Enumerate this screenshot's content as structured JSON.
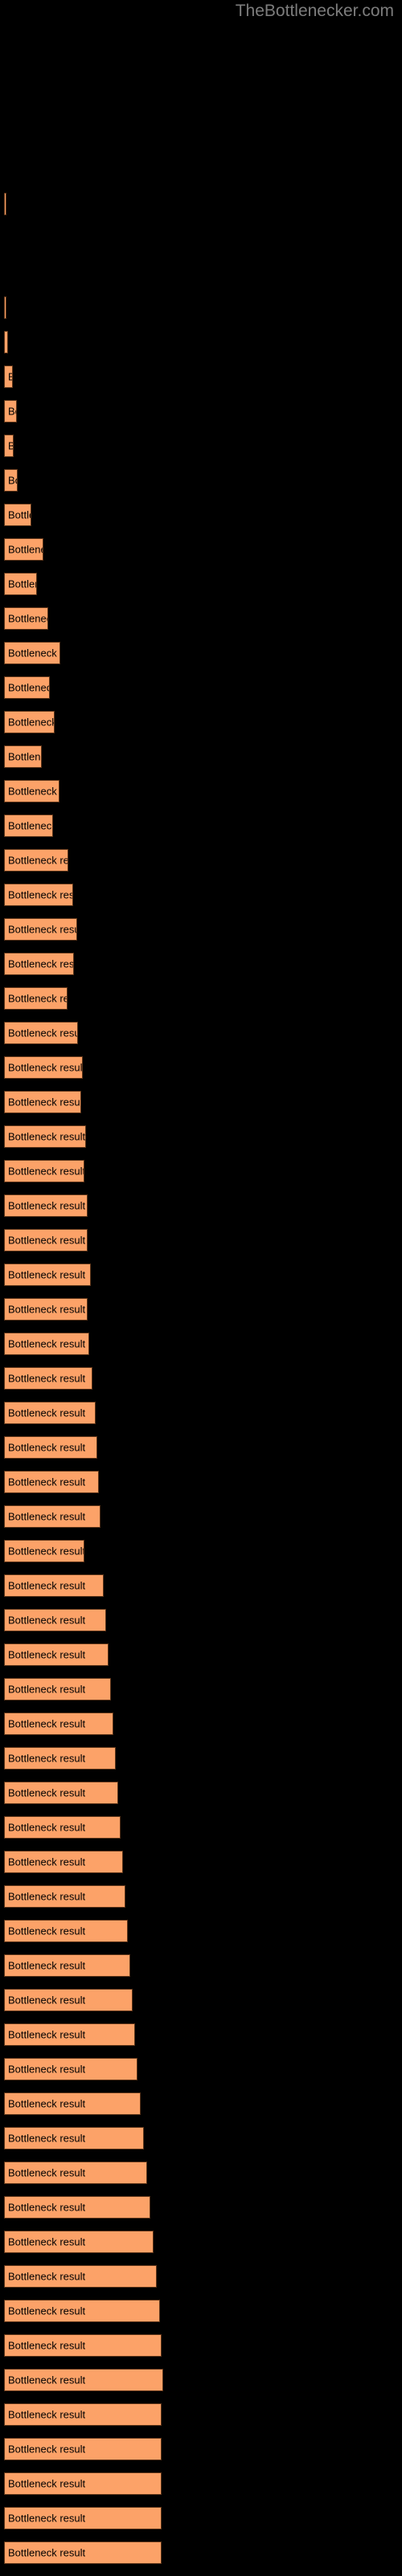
{
  "header": {
    "site_title": "TheBottlenecker.com",
    "title_color": "#7d7d7d"
  },
  "colors": {
    "background": "#000000",
    "bar_fill": "#fca268",
    "bar_border": "#5a3318",
    "bar_label_text": "#000000"
  },
  "chart_data": {
    "type": "bar",
    "orientation": "horizontal",
    "title": "",
    "subtitle": "",
    "xlabel": "",
    "ylabel": "",
    "grid": false,
    "legend": null,
    "axis_visible": false,
    "categories": [
      "",
      "",
      "",
      "",
      "",
      "",
      "",
      "",
      "",
      "",
      "",
      "",
      "",
      "",
      "",
      "",
      "",
      "",
      "",
      "",
      "",
      "",
      "",
      "",
      "",
      "",
      "",
      "",
      "",
      "",
      "",
      "",
      "",
      "",
      "",
      "",
      "",
      "",
      "",
      "",
      "",
      "",
      "",
      "",
      ""
    ],
    "bar_label_text": "Bottleneck result",
    "xlim": [
      0,
      500
    ],
    "values": [
      0,
      0,
      0,
      0,
      0,
      1,
      0,
      0,
      0,
      0,
      0,
      1,
      0,
      0,
      1,
      9,
      14,
      10,
      15,
      19,
      30,
      44,
      57,
      47,
      61,
      70,
      55,
      80,
      65,
      84,
      72,
      95,
      105,
      96,
      114,
      106,
      124,
      115,
      133,
      126,
      146,
      137,
      155,
      148,
      191
    ],
    "bars": [
      {
        "index": 1,
        "y": 240,
        "width": 3,
        "label": "",
        "label_visible": false
      },
      {
        "index": 2,
        "y": 369,
        "width": 3,
        "label": "",
        "label_visible": false
      },
      {
        "index": 3,
        "y": 412,
        "width": 5,
        "label": "",
        "label_visible": false
      },
      {
        "index": 4,
        "y": 455,
        "width": 11,
        "label": "Bottleneck result",
        "label_visible": true
      },
      {
        "index": 5,
        "y": 498,
        "width": 16,
        "label": "Bottleneck result",
        "label_visible": true
      },
      {
        "index": 6,
        "y": 541,
        "width": 12,
        "label": "Bottleneck result",
        "label_visible": true
      },
      {
        "index": 7,
        "y": 584,
        "width": 17,
        "label": "Bottleneck result",
        "label_visible": true
      },
      {
        "index": 8,
        "y": 627,
        "width": 34,
        "label": "Bottleneck result",
        "label_visible": true
      },
      {
        "index": 9,
        "y": 670,
        "width": 49,
        "label": "Bottleneck result",
        "label_visible": true
      },
      {
        "index": 10,
        "y": 713,
        "width": 41,
        "label": "Bottleneck result",
        "label_visible": true
      },
      {
        "index": 11,
        "y": 756,
        "width": 55,
        "label": "Bottleneck result",
        "label_visible": true
      },
      {
        "index": 12,
        "y": 799,
        "width": 70,
        "label": "Bottleneck result",
        "label_visible": true
      },
      {
        "index": 13,
        "y": 842,
        "width": 57,
        "label": "Bottleneck result",
        "label_visible": true
      },
      {
        "index": 14,
        "y": 885,
        "width": 63,
        "label": "Bottleneck result",
        "label_visible": true
      },
      {
        "index": 15,
        "y": 928,
        "width": 47,
        "label": "Bottleneck result",
        "label_visible": true
      },
      {
        "index": 16,
        "y": 971,
        "width": 69,
        "label": "Bottleneck result",
        "label_visible": true
      },
      {
        "index": 17,
        "y": 1014,
        "width": 61,
        "label": "Bottleneck result",
        "label_visible": true
      },
      {
        "index": 18,
        "y": 1057,
        "width": 80,
        "label": "Bottleneck result",
        "label_visible": true
      },
      {
        "index": 19,
        "y": 1100,
        "width": 86,
        "label": "Bottleneck result",
        "label_visible": true
      },
      {
        "index": 20,
        "y": 1143,
        "width": 91,
        "label": "Bottleneck result",
        "label_visible": true
      },
      {
        "index": 21,
        "y": 1186,
        "width": 87,
        "label": "Bottleneck result",
        "label_visible": true
      },
      {
        "index": 22,
        "y": 1229,
        "width": 79,
        "label": "Bottleneck result",
        "label_visible": true
      },
      {
        "index": 23,
        "y": 1272,
        "width": 92,
        "label": "Bottleneck result",
        "label_visible": true
      },
      {
        "index": 24,
        "y": 1315,
        "width": 98,
        "label": "Bottleneck result",
        "label_visible": true
      },
      {
        "index": 25,
        "y": 1358,
        "width": 96,
        "label": "Bottleneck result",
        "label_visible": true
      },
      {
        "index": 26,
        "y": 1401,
        "width": 102,
        "label": "Bottleneck result",
        "label_visible": true
      },
      {
        "index": 27,
        "y": 1444,
        "width": 100,
        "label": "Bottleneck result",
        "label_visible": true
      },
      {
        "index": 28,
        "y": 1487,
        "width": 104,
        "label": "Bottleneck result",
        "label_visible": true
      },
      {
        "index": 29,
        "y": 1530,
        "width": 104,
        "label": "Bottleneck result",
        "label_visible": true
      },
      {
        "index": 30,
        "y": 1573,
        "width": 108,
        "label": "Bottleneck result",
        "label_visible": true
      },
      {
        "index": 31,
        "y": 1616,
        "width": 104,
        "label": "Bottleneck result",
        "label_visible": true
      },
      {
        "index": 32,
        "y": 1659,
        "width": 106,
        "label": "Bottleneck result",
        "label_visible": true
      },
      {
        "index": 33,
        "y": 1702,
        "width": 110,
        "label": "Bottleneck result",
        "label_visible": true
      },
      {
        "index": 34,
        "y": 1745,
        "width": 114,
        "label": "Bottleneck result",
        "label_visible": true
      },
      {
        "index": 35,
        "y": 1788,
        "width": 116,
        "label": "Bottleneck result",
        "label_visible": true
      },
      {
        "index": 36,
        "y": 1831,
        "width": 118,
        "label": "Bottleneck result",
        "label_visible": true
      },
      {
        "index": 37,
        "y": 1874,
        "width": 120,
        "label": "Bottleneck result",
        "label_visible": true
      },
      {
        "index": 38,
        "y": 1917,
        "width": 100,
        "label": "Bottleneck result",
        "label_visible": true
      },
      {
        "index": 39,
        "y": 1960,
        "width": 124,
        "label": "Bottleneck result",
        "label_visible": true
      },
      {
        "index": 40,
        "y": 2003,
        "width": 127,
        "label": "Bottleneck result",
        "label_visible": true
      },
      {
        "index": 41,
        "y": 2046,
        "width": 130,
        "label": "Bottleneck result",
        "label_visible": true
      },
      {
        "index": 42,
        "y": 2089,
        "width": 133,
        "label": "Bottleneck result",
        "label_visible": true
      },
      {
        "index": 43,
        "y": 2132,
        "width": 136,
        "label": "Bottleneck result",
        "label_visible": true
      },
      {
        "index": 44,
        "y": 2175,
        "width": 139,
        "label": "Bottleneck result",
        "label_visible": true
      },
      {
        "index": 45,
        "y": 2218,
        "width": 142,
        "label": "Bottleneck result",
        "label_visible": true
      },
      {
        "index": 46,
        "y": 2261,
        "width": 145,
        "label": "Bottleneck result",
        "label_visible": true
      },
      {
        "index": 47,
        "y": 2304,
        "width": 148,
        "label": "Bottleneck result",
        "label_visible": true
      },
      {
        "index": 48,
        "y": 2347,
        "width": 151,
        "label": "Bottleneck result",
        "label_visible": true
      },
      {
        "index": 49,
        "y": 2390,
        "width": 154,
        "label": "Bottleneck result",
        "label_visible": true
      },
      {
        "index": 50,
        "y": 2433,
        "width": 157,
        "label": "Bottleneck result",
        "label_visible": true
      },
      {
        "index": 51,
        "y": 2476,
        "width": 160,
        "label": "Bottleneck result",
        "label_visible": true
      },
      {
        "index": 52,
        "y": 2519,
        "width": 163,
        "label": "Bottleneck result",
        "label_visible": true
      },
      {
        "index": 53,
        "y": 2562,
        "width": 166,
        "label": "Bottleneck result",
        "label_visible": true
      },
      {
        "index": 54,
        "y": 2605,
        "width": 170,
        "label": "Bottleneck result",
        "label_visible": true
      },
      {
        "index": 55,
        "y": 2648,
        "width": 174,
        "label": "Bottleneck result",
        "label_visible": true
      },
      {
        "index": 56,
        "y": 2691,
        "width": 178,
        "label": "Bottleneck result",
        "label_visible": true
      },
      {
        "index": 57,
        "y": 2734,
        "width": 182,
        "label": "Bottleneck result",
        "label_visible": true
      },
      {
        "index": 58,
        "y": 2777,
        "width": 186,
        "label": "Bottleneck result",
        "label_visible": true
      },
      {
        "index": 59,
        "y": 2820,
        "width": 190,
        "label": "Bottleneck result",
        "label_visible": true
      },
      {
        "index": 60,
        "y": 2863,
        "width": 194,
        "label": "Bottleneck result",
        "label_visible": true
      },
      {
        "index": 61,
        "y": 2906,
        "width": 196,
        "label": "Bottleneck result",
        "label_visible": true
      },
      {
        "index": 62,
        "y": 2949,
        "width": 198,
        "label": "Bottleneck result",
        "label_visible": true
      },
      {
        "index": 63,
        "y": 2992,
        "width": 196,
        "label": "Bottleneck result",
        "label_visible": true
      },
      {
        "index": 64,
        "y": 3035,
        "width": 196,
        "label": "Bottleneck result",
        "label_visible": true
      },
      {
        "index": 65,
        "y": 3078,
        "width": 196,
        "label": "Bottleneck result",
        "label_visible": true
      },
      {
        "index": 66,
        "y": 3121,
        "width": 196,
        "label": "Bottleneck result",
        "label_visible": true
      },
      {
        "index": 67,
        "y": 3164,
        "width": 196,
        "label": "Bottleneck result",
        "label_visible": true
      }
    ]
  }
}
